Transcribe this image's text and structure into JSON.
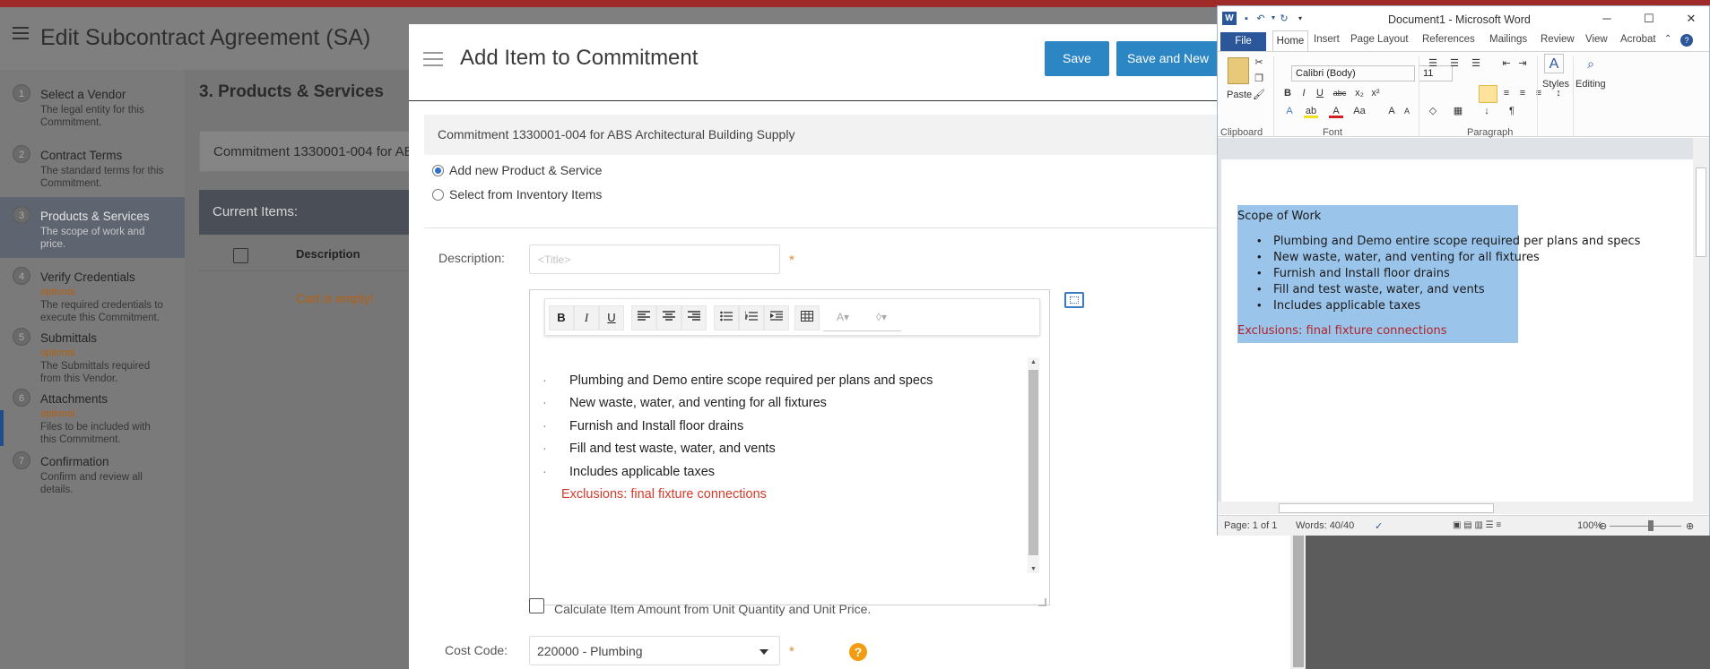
{
  "app": {
    "title": "Edit Subcontract Agreement (SA)",
    "section_title": "3. Products & Services",
    "commitment_short": "Commitment 1330001-004 for AB",
    "current_items": "Current Items:",
    "table_desc_header": "Description",
    "cart_empty": "Cart is empty!"
  },
  "steps": [
    {
      "num": "1",
      "title": "Select a Vendor",
      "optional": "",
      "desc1": "The legal entity for this",
      "desc2": "Commitment."
    },
    {
      "num": "2",
      "title": "Contract Terms",
      "optional": "",
      "desc1": "The standard terms for this",
      "desc2": "Commitment."
    },
    {
      "num": "3",
      "title": "Products & Services",
      "optional": "",
      "desc1": "The scope of work and",
      "desc2": "price."
    },
    {
      "num": "4",
      "title": "Verify Credentials",
      "optional": "optional",
      "desc1": "The required credentials to",
      "desc2": "execute this Commitment."
    },
    {
      "num": "5",
      "title": "Submittals",
      "optional": "optional",
      "desc1": "The Submittals required",
      "desc2": "from this Vendor."
    },
    {
      "num": "6",
      "title": "Attachments",
      "optional": "optional",
      "desc1": "Files to be included with",
      "desc2": "this Commitment."
    },
    {
      "num": "7",
      "title": "Confirmation",
      "optional": "",
      "desc1": "Confirm and review all",
      "desc2": "details."
    }
  ],
  "modal": {
    "title": "Add Item to Commitment",
    "save": "Save",
    "save_new": "Save and New",
    "commitment": "Commitment 1330001-004 for ABS Architectural Building Supply",
    "radio_new": "Add new Product & Service",
    "radio_inventory": "Select from Inventory Items",
    "description_label": "Description:",
    "title_placeholder": "<Title>",
    "required": "*",
    "toolbar": {
      "bold": "B",
      "italic": "I",
      "underline": "U",
      "font_color": "A▾",
      "fill_color": "◊▾"
    },
    "bullets": [
      "Plumbing and Demo entire scope required per plans and specs",
      "New waste, water, and venting for all fixtures",
      "Furnish and Install floor drains",
      "Fill and test waste, water, and vents",
      "Includes applicable taxes"
    ],
    "bullet_char": "·",
    "exclusions": "Exclusions: final fixture connections",
    "calc_label": "Calculate Item Amount from Unit Quantity and Unit Price.",
    "cost_code_label": "Cost Code:",
    "cost_code_value": "220000 - Plumbing",
    "help": "?"
  },
  "word": {
    "title": "Document1  -  Microsoft Word",
    "tabs": [
      "File",
      "Home",
      "Insert",
      "Page Layout",
      "References",
      "Mailings",
      "Review",
      "View",
      "Acrobat"
    ],
    "font": "Calibri (Body)",
    "size": "11",
    "groups": {
      "clipboard": "Clipboard",
      "font": "Font",
      "paragraph": "Paragraph"
    },
    "paste": "Paste",
    "styles": "Styles",
    "editing": "Editing",
    "doc_heading": "Scope of Work",
    "doc_bullets": [
      "Plumbing and Demo entire scope required per plans and specs",
      "New waste, water, and venting for all fixtures",
      "Furnish and Install floor drains",
      "Fill and test waste, water, and vents",
      "Includes applicable taxes"
    ],
    "doc_exclusions": "Exclusions: final fixture connections",
    "bullet_char": "•",
    "status_page": "Page: 1 of 1",
    "status_words": "Words: 40/40",
    "zoom": "100%"
  },
  "colors": {
    "primary_button": "#2c86c4",
    "required": "#e08a2a",
    "exclusions_red": "#d63a2a",
    "word_blue": "#2b579a",
    "selection": "#9bc4ea"
  }
}
